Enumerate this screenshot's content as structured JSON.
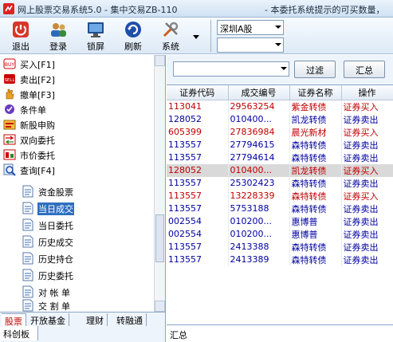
{
  "window": {
    "title": "网上股票交易系统5.0 - 集中交易ZB-110",
    "notice": "- 本委托系统提示的可买数量，"
  },
  "toolbar": {
    "buttons": [
      {
        "label": "退出",
        "icon": "exit-icon"
      },
      {
        "label": "登录",
        "icon": "login-icon"
      },
      {
        "label": "锁屏",
        "icon": "lock-screen-icon"
      },
      {
        "label": "刷新",
        "icon": "refresh-icon"
      },
      {
        "label": "系统",
        "icon": "tools-icon"
      }
    ],
    "market_select": "深圳A股",
    "account_select": ""
  },
  "tree": {
    "items": [
      {
        "label": "买入[F1]",
        "icon": "buy-icon"
      },
      {
        "label": "卖出[F2]",
        "icon": "sell-icon"
      },
      {
        "label": "撤单[F3]",
        "icon": "cancel-hand-icon"
      },
      {
        "label": "条件单",
        "icon": "condition-order-icon"
      },
      {
        "label": "新股申购",
        "icon": "ipo-subscribe-icon"
      },
      {
        "label": "双向委托",
        "icon": "two-way-order-icon"
      },
      {
        "label": "市价委托",
        "icon": "market-order-icon"
      },
      {
        "label": "查询[F4]",
        "icon": "query-icon"
      },
      {
        "label": "资金股票",
        "icon": "document-icon"
      },
      {
        "label": "当日成交",
        "icon": "document-icon"
      },
      {
        "label": "当日委托",
        "icon": "document-icon"
      },
      {
        "label": "历史成交",
        "icon": "document-icon"
      },
      {
        "label": "历史持仓",
        "icon": "document-icon"
      },
      {
        "label": "历史委托",
        "icon": "document-icon"
      },
      {
        "label": "对 帐 单",
        "icon": "document-icon"
      },
      {
        "label": "交 割 单",
        "icon": "document-icon"
      }
    ],
    "selected": "当日成交"
  },
  "bottom_tabs": [
    "股票",
    "开放基金",
    "理财",
    "转融通"
  ],
  "bottom_subtab": "科创板",
  "filter": {
    "select_value": "",
    "filter_button": "过滤",
    "summary_button": "汇总"
  },
  "table": {
    "columns": [
      "证券代码",
      "成交编号",
      "证券名称",
      "操作"
    ],
    "rows": [
      {
        "code": "113041",
        "no": "29563254",
        "name": "紫金转债",
        "op": "证券买入",
        "side": "buy"
      },
      {
        "code": "128052",
        "no": "010400...",
        "name": "凯龙转债",
        "op": "证券卖出",
        "side": "sell"
      },
      {
        "code": "605399",
        "no": "27836984",
        "name": "晨光新材",
        "op": "证券买入",
        "side": "buy"
      },
      {
        "code": "113557",
        "no": "27794615",
        "name": "森特转债",
        "op": "证券卖出",
        "side": "sell"
      },
      {
        "code": "113557",
        "no": "27794614",
        "name": "森特转债",
        "op": "证券卖出",
        "side": "sell"
      },
      {
        "code": "128052",
        "no": "010400...",
        "name": "凯龙转债",
        "op": "证券买入",
        "side": "buy",
        "selected": true
      },
      {
        "code": "113557",
        "no": "25302423",
        "name": "森特转债",
        "op": "证券卖出",
        "side": "sell"
      },
      {
        "code": "113557",
        "no": "13228339",
        "name": "森特转债",
        "op": "证券买入",
        "side": "buy"
      },
      {
        "code": "113557",
        "no": "5753188",
        "name": "森特转债",
        "op": "证券卖出",
        "side": "sell"
      },
      {
        "code": "002554",
        "no": "010200...",
        "name": "惠博普",
        "op": "证券卖出",
        "side": "sell"
      },
      {
        "code": "002554",
        "no": "010200...",
        "name": "惠博普",
        "op": "证券卖出",
        "side": "sell"
      },
      {
        "code": "113557",
        "no": "2413388",
        "name": "森特转债",
        "op": "证券卖出",
        "side": "sell"
      },
      {
        "code": "113557",
        "no": "2413389",
        "name": "森特转债",
        "op": "证券卖出",
        "side": "sell"
      }
    ],
    "summary_label": "汇总"
  },
  "colors": {
    "buy_text": "#c00000",
    "sell_text": "#0000a0",
    "selection": "#2f6fbf"
  }
}
